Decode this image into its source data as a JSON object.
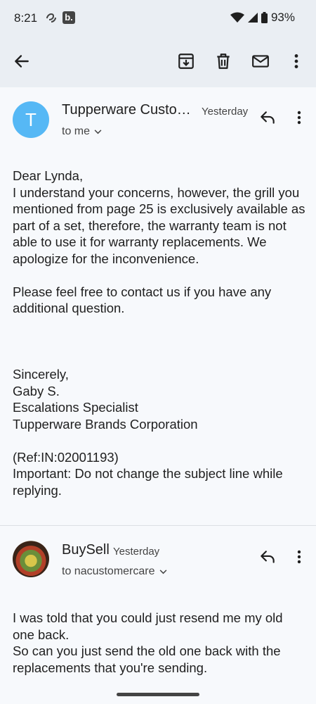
{
  "status_bar": {
    "time": "8:21",
    "b_icon_label": "b.",
    "battery": "93%"
  },
  "toolbar": {
    "back_icon": "arrow-left-icon",
    "archive_icon": "archive-icon",
    "delete_icon": "trash-icon",
    "mark_unread_icon": "mail-icon",
    "more_icon": "more-vert-icon"
  },
  "messages": [
    {
      "avatar_letter": "T",
      "sender": "Tupperware Custo…",
      "date": "Yesterday",
      "recipient": "to me",
      "body": "Dear Lynda,\nI understand your concerns, however, the grill you mentioned from page 25 is exclusively available as part of a set, therefore, the warranty team is not able to use it for warranty replacements. We apologize  for the inconvenience.\n\nPlease feel free to contact us if you have any additional question.\n\n\n\nSincerely,\nGaby S.\nEscalations Specialist\nTupperware Brands Corporation\n\n(Ref:IN:02001193)\nImportant: Do not change the subject line while replying."
    },
    {
      "sender": "BuySell",
      "date": "Yesterday",
      "recipient": "to nacustomercare",
      "body": "I was told that you could just resend me my old one back.\nSo can you just send the old one back with the replacements that you're sending."
    }
  ]
}
